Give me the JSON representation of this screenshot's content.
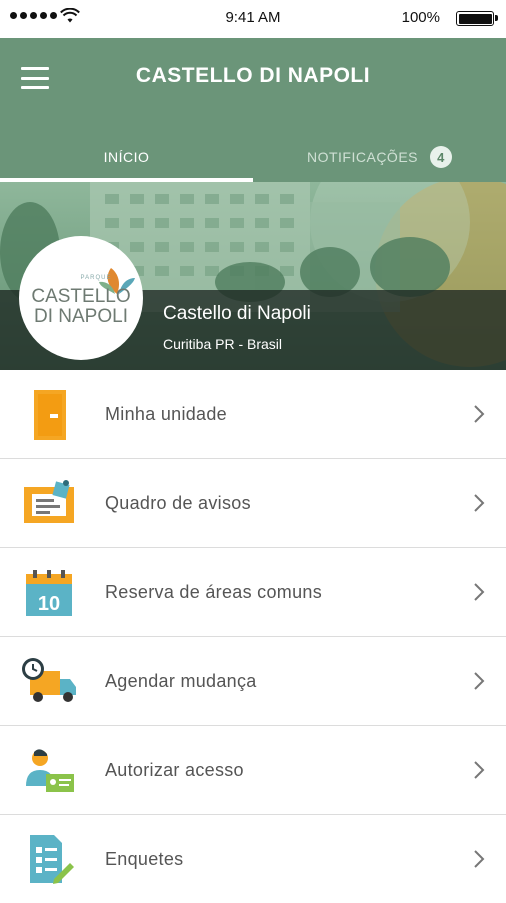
{
  "status_bar": {
    "time": "9:41 AM",
    "battery": "100%"
  },
  "header": {
    "title": "CASTELLO DI NAPOLI"
  },
  "tabs": [
    {
      "label": "INÍCIO"
    },
    {
      "label": "NOTIFICAÇÕES",
      "badge": "4"
    }
  ],
  "condo": {
    "logo_small": "PARQUE",
    "logo_line1": "CASTELLO",
    "logo_line2": "DI NAPOLI",
    "name": "Castello di Napoli",
    "location": "Curitiba PR - Brasil"
  },
  "menu": [
    {
      "label": "Minha unidade",
      "icon": "door-icon"
    },
    {
      "label": "Quadro de avisos",
      "icon": "notice-board-icon"
    },
    {
      "label": "Reserva de áreas comuns",
      "icon": "calendar-icon",
      "icon_text": "10"
    },
    {
      "label": "Agendar mudança",
      "icon": "moving-truck-icon"
    },
    {
      "label": "Autorizar acesso",
      "icon": "visitor-access-icon"
    },
    {
      "label": "Enquetes",
      "icon": "survey-icon"
    }
  ],
  "colors": {
    "primary": "#6b9579",
    "accent_orange": "#f5a623",
    "accent_teal": "#5bb3c6"
  }
}
